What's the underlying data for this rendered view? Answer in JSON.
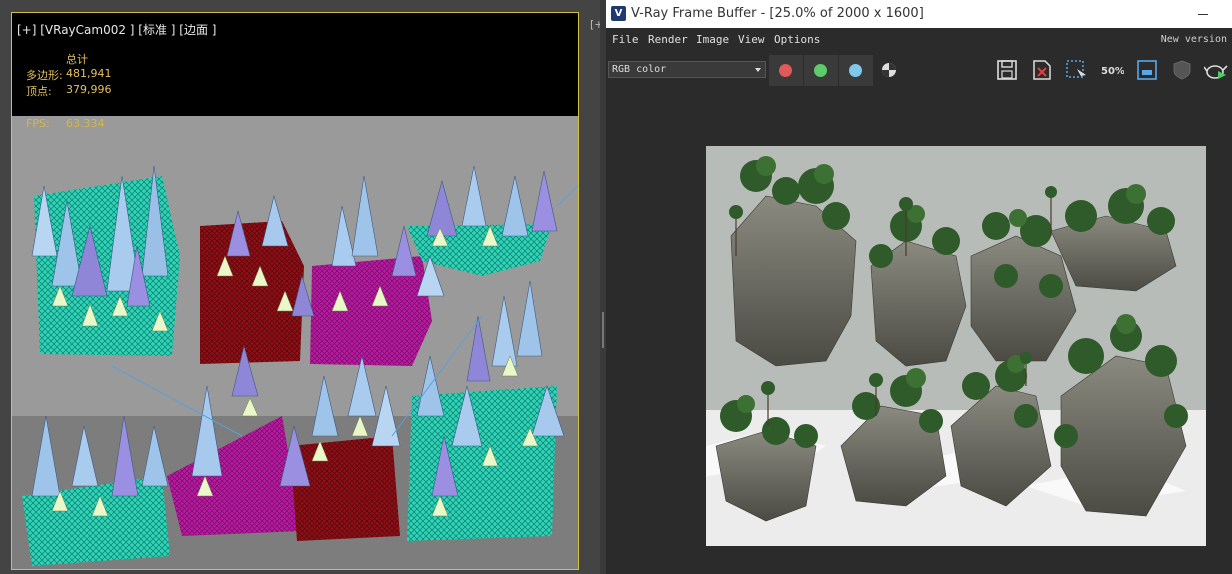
{
  "viewport": {
    "label": "[+] [VRayCam002 ] [标准 ] [边面 ]",
    "stats_header": "总计",
    "polygons_label": "多边形:",
    "polygons_value": "481,941",
    "vertices_label": "顶点:",
    "vertices_value": "379,996",
    "fps_label": "FPS:",
    "fps_value": "63.334",
    "side_tab": "[+"
  },
  "vfb": {
    "title": "V-Ray Frame Buffer - [25.0% of 2000 x 1600]",
    "logo": "V",
    "menu": [
      "File",
      "Render",
      "Image",
      "View",
      "Options"
    ],
    "new_version": "New version",
    "channel": "RGB color",
    "colors": {
      "red": "#e05a5a",
      "green": "#5fca6a",
      "blue": "#7ec8ec"
    },
    "zoom_icon_text": "50%"
  }
}
